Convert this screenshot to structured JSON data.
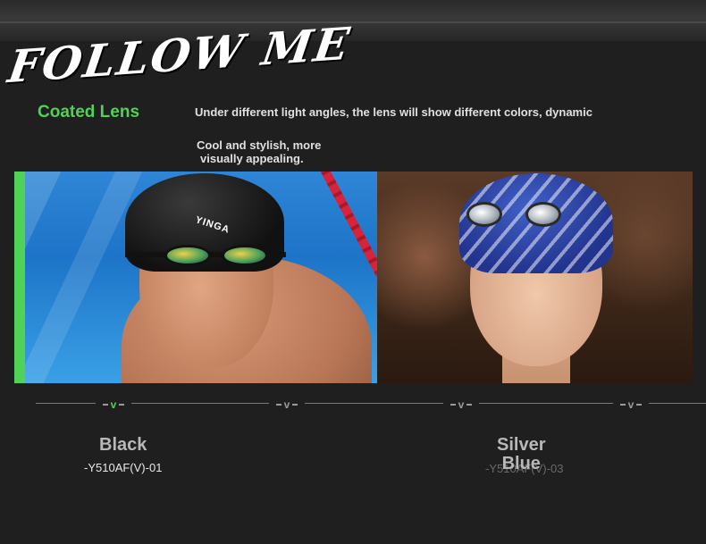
{
  "banner": {
    "headline": "FOLLOW ME",
    "feature_title": "Coated Lens",
    "description_line1": "Under different light angles, the lens will show different colors, dynamic",
    "description_line2a": "Cool and stylish, more",
    "description_line2b": "visually appealing."
  },
  "colors": {
    "accent": "#4fd255",
    "background": "#1f1f1f"
  },
  "products": [
    {
      "name_line1": "Black",
      "name_line2": "",
      "sku": "-Y510AF(V)-01",
      "photo": "swimmer-black-cap",
      "cap_logo": "YINGA"
    },
    {
      "name_line1": "Silver",
      "name_line2": "Blue",
      "sku": "-Y510AF(V)-03",
      "photo": "swimmer-blue-cap"
    }
  ],
  "selector": {
    "active_index": 0,
    "icons": [
      "chevron-down-icon",
      "chevron-down-icon",
      "chevron-down-icon",
      "chevron-down-icon"
    ],
    "glyph": "v"
  }
}
